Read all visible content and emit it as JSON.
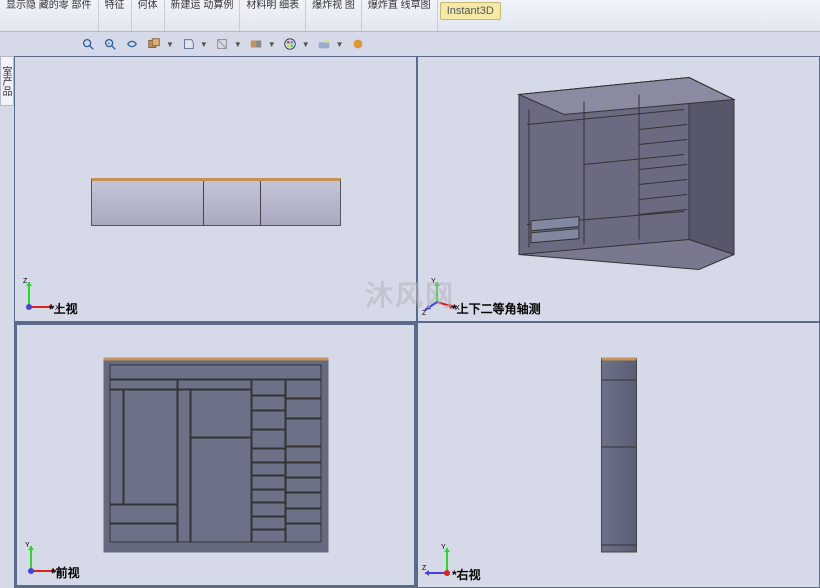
{
  "ribbon": {
    "groups": [
      {
        "label": "显示隐\n藏的零\n部件"
      },
      {
        "label": "特征"
      },
      {
        "label": "何体"
      },
      {
        "label": "新建运\n动算例"
      },
      {
        "label": "材料明\n细表"
      },
      {
        "label": "爆炸视\n图"
      },
      {
        "label": "爆炸直\n线草图"
      }
    ],
    "instant3d": "Instant3D"
  },
  "side_tab": "室产品",
  "views": {
    "tl": {
      "label": "*上视"
    },
    "tr": {
      "label": "*上下二等角轴测"
    },
    "bl": {
      "label": "*前视"
    },
    "br": {
      "label": "*右视"
    }
  },
  "watermark": "沐风网"
}
